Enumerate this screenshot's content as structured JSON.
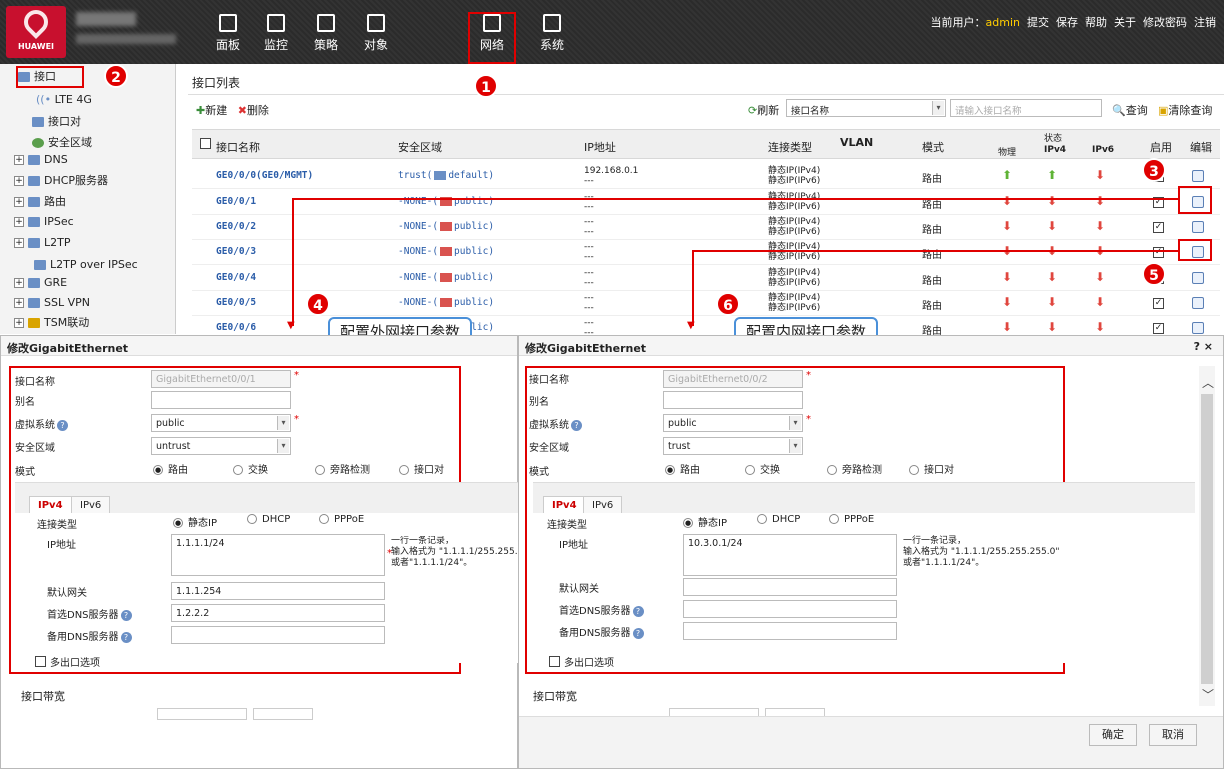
{
  "header": {
    "logo_text": "HUAWEI",
    "user_label": "当前用户：",
    "user": "admin",
    "links": [
      "提交",
      "保存",
      "帮助",
      "关于",
      "修改密码",
      "注销"
    ]
  },
  "nav": [
    {
      "label": "面板",
      "icon": "dashboard-icon"
    },
    {
      "label": "监控",
      "icon": "monitor-icon"
    },
    {
      "label": "策略",
      "icon": "policy-icon"
    },
    {
      "label": "对象",
      "icon": "object-icon"
    },
    {
      "label": "网络",
      "icon": "network-icon"
    },
    {
      "label": "系统",
      "icon": "system-icon"
    }
  ],
  "sidebar": {
    "items": [
      {
        "label": "接口"
      },
      {
        "label": "LTE 4G"
      },
      {
        "label": "接口对"
      },
      {
        "label": "安全区域"
      },
      {
        "label": "DNS"
      },
      {
        "label": "DHCP服务器"
      },
      {
        "label": "路由"
      },
      {
        "label": "IPSec"
      },
      {
        "label": "L2TP"
      },
      {
        "label": "L2TP over IPSec"
      },
      {
        "label": "GRE"
      },
      {
        "label": "SSL VPN"
      },
      {
        "label": "TSM联动"
      }
    ]
  },
  "list": {
    "title": "接口列表",
    "new": "新建",
    "delete": "删除",
    "refresh": "刷新",
    "filter_field": "接口名称",
    "search_placeholder": "请输入接口名称",
    "query": "查询",
    "clear": "清除查询",
    "columns": {
      "name": "接口名称",
      "zone": "安全区域",
      "ip": "IP地址",
      "conn": "连接类型",
      "vlan": "VLAN",
      "mode": "模式",
      "status": "状态",
      "phys": "物理",
      "ipv4": "IPv4",
      "ipv6": "IPv6",
      "enable": "启用",
      "edit": "编辑"
    },
    "rows": [
      {
        "name": "GE0/0/0(GE0/MGMT)",
        "zone": "trust(",
        "vsys": "default)",
        "ip": "192.168.0.1",
        "ip2": "---",
        "conn1": "静态IP(IPv4)",
        "conn2": "静态IP(IPv6)",
        "mode": "路由"
      },
      {
        "name": "GE0/0/1",
        "zone": "-NONE-(",
        "vsys": "public)",
        "ip": "---",
        "ip2": "---",
        "conn1": "静态IP(IPv4)",
        "conn2": "静态IP(IPv6)",
        "mode": "路由"
      },
      {
        "name": "GE0/0/2",
        "zone": "-NONE-(",
        "vsys": "public)",
        "ip": "---",
        "ip2": "---",
        "conn1": "静态IP(IPv4)",
        "conn2": "静态IP(IPv6)",
        "mode": "路由"
      },
      {
        "name": "GE0/0/3",
        "zone": "-NONE-(",
        "vsys": "public)",
        "ip": "---",
        "ip2": "---",
        "conn1": "静态IP(IPv4)",
        "conn2": "静态IP(IPv6)",
        "mode": "路由"
      },
      {
        "name": "GE0/0/4",
        "zone": "-NONE-(",
        "vsys": "public)",
        "ip": "---",
        "ip2": "---",
        "conn1": "静态IP(IPv4)",
        "conn2": "静态IP(IPv6)",
        "mode": "路由"
      },
      {
        "name": "GE0/0/5",
        "zone": "-NONE-(",
        "vsys": "public)",
        "ip": "---",
        "ip2": "---",
        "conn1": "静态IP(IPv4)",
        "conn2": "静态IP(IPv6)",
        "mode": "路由"
      },
      {
        "name": "GE0/0/6",
        "zone": "-NONE-(",
        "vsys": "public)",
        "ip": "---",
        "ip2": "---",
        "conn1": "静态IP(IPv4)",
        "conn2": "",
        "mode": "路由"
      }
    ]
  },
  "annotations": {
    "b1": "1",
    "b2": "2",
    "b3": "3",
    "b4": "4",
    "b5": "5",
    "b6": "6",
    "callout_ext": "配置外网接口参数",
    "callout_int": "配置内网接口参数"
  },
  "dialog_left": {
    "title": "修改GigabitEthernet",
    "name_label": "接口名称",
    "name_value": "GigabitEthernet0/0/1",
    "alias_label": "别名",
    "alias_value": "",
    "vsys_label": "虚拟系统",
    "vsys_value": "public",
    "zone_label": "安全区域",
    "zone_value": "untrust",
    "mode_label": "模式",
    "mode_opts": [
      "路由",
      "交换",
      "旁路检测",
      "接口对"
    ],
    "tab_v4": "IPv4",
    "tab_v6": "IPv6",
    "conn_label": "连接类型",
    "conn_opts": [
      "静态IP",
      "DHCP",
      "PPPoE"
    ],
    "ip_label": "IP地址",
    "ip_value": "1.1.1.1/24",
    "note": "一行一条记录，\n输入格式为 \"1.1.1.1/255.255.\n或者\"1.1.1.1/24\"。",
    "gw_label": "默认网关",
    "gw_value": "1.1.1.254",
    "dns1_label": "首选DNS服务器",
    "dns1_value": "1.2.2.2",
    "dns2_label": "备用DNS服务器",
    "dns2_value": "",
    "multi_label": "多出口选项",
    "bw_label": "接口带宽"
  },
  "dialog_right": {
    "title": "修改GigabitEthernet",
    "close": "? ×",
    "name_label": "接口名称",
    "name_value": "GigabitEthernet0/0/2",
    "alias_label": "别名",
    "alias_value": "",
    "vsys_label": "虚拟系统",
    "vsys_value": "public",
    "zone_label": "安全区域",
    "zone_value": "trust",
    "mode_label": "模式",
    "mode_opts": [
      "路由",
      "交换",
      "旁路检测",
      "接口对"
    ],
    "tab_v4": "IPv4",
    "tab_v6": "IPv6",
    "conn_label": "连接类型",
    "conn_opts": [
      "静态IP",
      "DHCP",
      "PPPoE"
    ],
    "ip_label": "IP地址",
    "ip_value": "10.3.0.1/24",
    "note": "一行一条记录，\n输入格式为 \"1.1.1.1/255.255.255.0\"\n或者\"1.1.1.1/24\"。",
    "gw_label": "默认网关",
    "gw_value": "",
    "dns1_label": "首选DNS服务器",
    "dns1_value": "",
    "dns2_label": "备用DNS服务器",
    "dns2_value": "",
    "multi_label": "多出口选项",
    "bw_label": "接口带宽",
    "ok": "确定",
    "cancel": "取消"
  }
}
